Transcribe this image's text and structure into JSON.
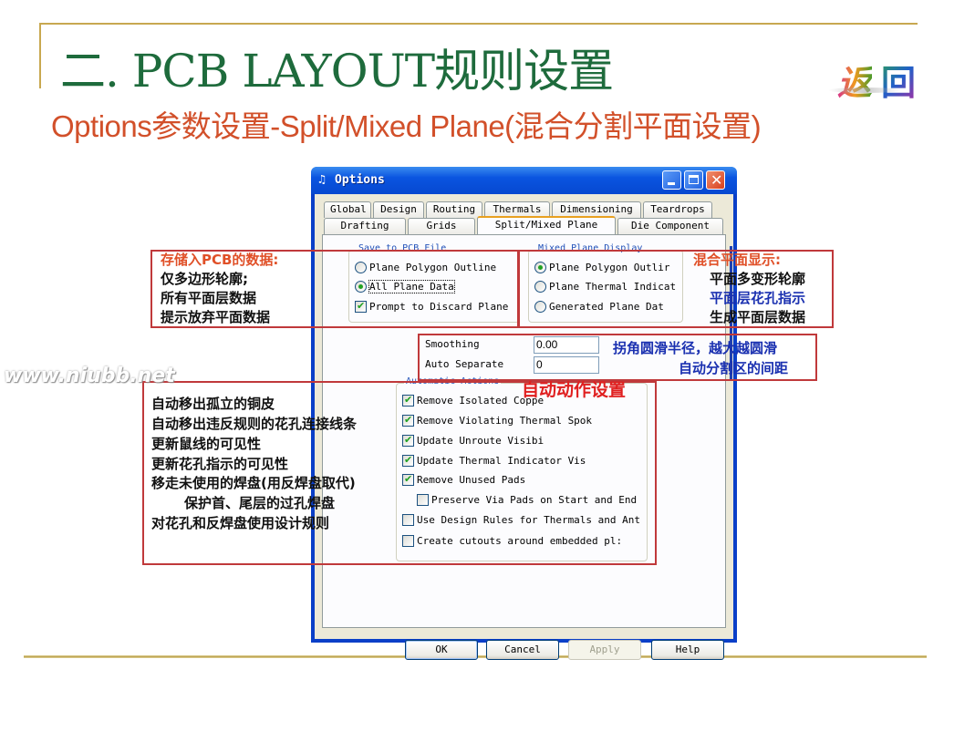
{
  "slide": {
    "title": "二. PCB LAYOUT规则设置",
    "subtitle": "Options参数设置-Split/Mixed Plane(混合分割平面设置)",
    "back_button": {
      "char1": "返",
      "char2": "回",
      "label": "返回"
    },
    "watermark": "www.niubb.net"
  },
  "window": {
    "title": "Options",
    "icon": "app-icon",
    "controls": [
      "minimize",
      "maximize",
      "close"
    ],
    "tabs_row1": [
      "Global",
      "Design",
      "Routing",
      "Thermals",
      "Dimensioning",
      "Teardrops"
    ],
    "tabs_row2": [
      "Drafting",
      "Grids",
      "Split/Mixed Plane",
      "Die Component"
    ],
    "active_tab": "Split/Mixed Plane",
    "save_group": {
      "legend": "Save to PCB File",
      "options": [
        {
          "label": "Plane Polygon Outline",
          "checked": false
        },
        {
          "label": "All Plane Data",
          "checked": true
        }
      ],
      "prompt": {
        "label": "Prompt to Discard Plane",
        "checked": true
      }
    },
    "display_group": {
      "legend": "Mixed Plane Display",
      "options": [
        {
          "label": "Plane Polygon Outlir",
          "checked": true
        },
        {
          "label": "Plane Thermal Indicat",
          "checked": false
        },
        {
          "label": "Generated Plane Dat",
          "checked": false
        }
      ]
    },
    "smoothing": {
      "label": "Smoothing",
      "value": "0.00"
    },
    "auto_separate": {
      "label": "Auto Separate",
      "value": "0"
    },
    "actions_group": {
      "legend": "Automatic Actions",
      "items": [
        {
          "label": "Remove Isolated Coppe",
          "checked": true
        },
        {
          "label": "Remove Violating Thermal Spok",
          "checked": true
        },
        {
          "label": "Update Unroute Visibi",
          "checked": true
        },
        {
          "label": "Update Thermal Indicator Vis",
          "checked": true
        },
        {
          "label": "Remove Unused Pads",
          "checked": true
        },
        {
          "label": "Preserve Via Pads on Start and End",
          "checked": false
        },
        {
          "label": "Use Design Rules for Thermals and Ant",
          "checked": false
        },
        {
          "label": "Create cutouts around embedded pl:",
          "checked": false
        }
      ]
    },
    "buttons": {
      "ok": "OK",
      "cancel": "Cancel",
      "apply": "Apply",
      "help": "Help"
    }
  },
  "annotations": {
    "save_notes": {
      "heading": "存储入PCB的数据:",
      "lines": [
        "仅多边形轮廓;",
        "所有平面层数据",
        "提示放弃平面数据"
      ]
    },
    "display_notes": {
      "heading": "混合平面显示:",
      "lines": [
        "平面多变形轮廓",
        "平面层花孔指示",
        "生成平面层数据"
      ]
    },
    "smoothing_notes": [
      "拐角圆滑半径，越大越圆滑",
      "自动分割区的间距"
    ],
    "actions_heading": "自动动作设置",
    "actions_notes": [
      "自动移出孤立的铜皮",
      "自动移出违反规则的花孔连接线条",
      "更新鼠线的可见性",
      "更新花孔指示的可见性",
      "移走未使用的焊盘(用反焊盘取代)",
      "保护首、尾层的过孔焊盘",
      "对花孔和反焊盘使用设计规则"
    ]
  },
  "colors": {
    "title_green": "#1e6b3c",
    "subtitle_orange": "#d2502a",
    "frame_gold": "#c8a850",
    "annotation_red": "#c0393b",
    "annotation_blue": "#1a30b0",
    "xp_titlebar_blue": "#0a54e0"
  }
}
